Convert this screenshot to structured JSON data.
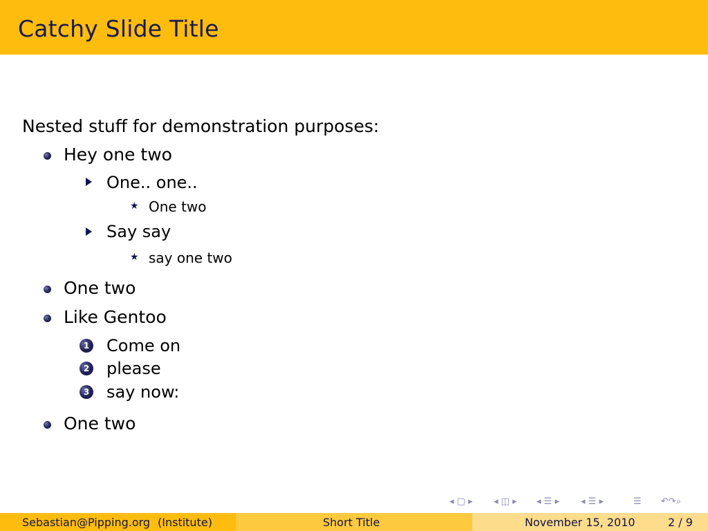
{
  "slide": {
    "title": "Catchy Slide Title",
    "intro": "Nested stuff for demonstration purposes:",
    "items": [
      {
        "text": "Hey one two",
        "children": [
          {
            "text": "One.. one..",
            "children": [
              {
                "text": "One two"
              }
            ]
          },
          {
            "text": "Say say",
            "children": [
              {
                "text": "say one two"
              }
            ]
          }
        ]
      },
      {
        "text": "One two"
      },
      {
        "text": "Like Gentoo",
        "enumerated": [
          {
            "num": "1",
            "text": "Come on"
          },
          {
            "num": "2",
            "text": "please"
          },
          {
            "num": "3",
            "text": "say now:"
          }
        ]
      },
      {
        "text": "One two"
      }
    ]
  },
  "footer": {
    "author": "Sebastian@Pipping.org",
    "institute": "(Institute)",
    "short_title": "Short Title",
    "date": "November 15, 2010",
    "page": "2 / 9"
  },
  "colors": {
    "accent": "#fdbc0e",
    "footer_left": "#fdbc0e",
    "footer_mid": "#fdc93e",
    "footer_right": "#fddc8c",
    "text_dark": "#141440"
  },
  "nav_icons": [
    "nav-slide-icon",
    "nav-frame-icon",
    "nav-subsection-icon",
    "nav-section-icon",
    "nav-doc-icon",
    "nav-search-icon"
  ]
}
